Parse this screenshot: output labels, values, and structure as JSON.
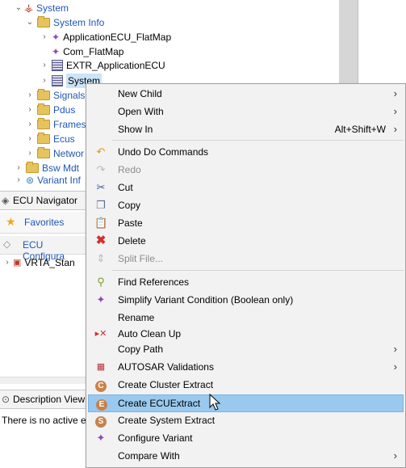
{
  "tree": {
    "system_root": "System",
    "system_info": "System Info",
    "app_flatmap": "ApplicationECU_FlatMap",
    "com_flatmap": "Com_FlatMap",
    "extr_app": "EXTR_ApplicationECU",
    "system_child": "System",
    "signals": "Signals",
    "pdus": "Pdus",
    "frames": "Frames",
    "ecus": "Ecus",
    "networks": "Networ",
    "bsw_mdt": "Bsw Mdt",
    "variant_info": "Variant Inf"
  },
  "ecu_navigator": {
    "tab_label": "ECU Navigator",
    "favorites": "Favorites",
    "ecu_config": "ECU Configura",
    "vrta_item": "VRTA_Stan"
  },
  "description_view": {
    "tab_label": "Description View",
    "message": "There is no active ec"
  },
  "menu": {
    "new_child": "New Child",
    "open_with": "Open With",
    "show_in": "Show In",
    "show_in_shortcut": "Alt+Shift+W",
    "undo": "Undo Do Commands",
    "redo": "Redo",
    "cut": "Cut",
    "copy": "Copy",
    "paste": "Paste",
    "delete": "Delete",
    "split_file": "Split File...",
    "find_references": "Find References",
    "simplify_variant": "Simplify Variant Condition (Boolean only)",
    "rename": "Rename",
    "auto_cleanup": "Auto Clean Up",
    "copy_path": "Copy Path",
    "autosar_validations": "AUTOSAR Validations",
    "create_cluster": "Create Cluster Extract",
    "create_ecu": "Create ECUExtract",
    "create_system": "Create System Extract",
    "configure_variant": "Configure Variant",
    "compare_with": "Compare With"
  },
  "colors": {
    "highlight": "#99c9ef",
    "menu_bg": "#f2f2f2",
    "tree_blue": "#1f57b4"
  }
}
